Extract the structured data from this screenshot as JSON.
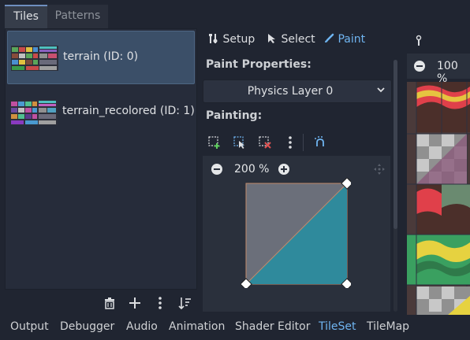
{
  "top_tabs": [
    {
      "label": "Tiles",
      "active": true
    },
    {
      "label": "Patterns",
      "active": false
    }
  ],
  "sources": [
    {
      "label": "terrain (ID: 0)",
      "selected": true
    },
    {
      "label": "terrain_recolored (ID: 1)",
      "selected": false
    }
  ],
  "left_toolbar": {
    "icons": [
      "trash-icon",
      "plus-icon",
      "kebab-menu-icon",
      "sort-icon"
    ]
  },
  "modes": [
    {
      "label": "Setup",
      "icon": "wrench-icon",
      "active": false
    },
    {
      "label": "Select",
      "icon": "cursor-icon",
      "active": false
    },
    {
      "label": "Paint",
      "icon": "brush-icon",
      "active": true
    }
  ],
  "paint_properties": {
    "heading": "Paint Properties:",
    "selected_property": "Physics Layer 0"
  },
  "painting": {
    "heading": "Painting:",
    "zoom": "200 %"
  },
  "right_panel": {
    "zoom": "100 %"
  },
  "bottom_tabs": [
    {
      "label": "Output",
      "active": false
    },
    {
      "label": "Debugger",
      "active": false
    },
    {
      "label": "Audio",
      "active": false
    },
    {
      "label": "Animation",
      "active": false
    },
    {
      "label": "Shader Editor",
      "active": false
    },
    {
      "label": "TileSet",
      "active": true
    },
    {
      "label": "TileMap",
      "active": false
    }
  ],
  "colors": {
    "accent": "#6fb4f0",
    "polygon_fill": "#2f8a9c",
    "tile_bg": "#6b6f7a"
  }
}
